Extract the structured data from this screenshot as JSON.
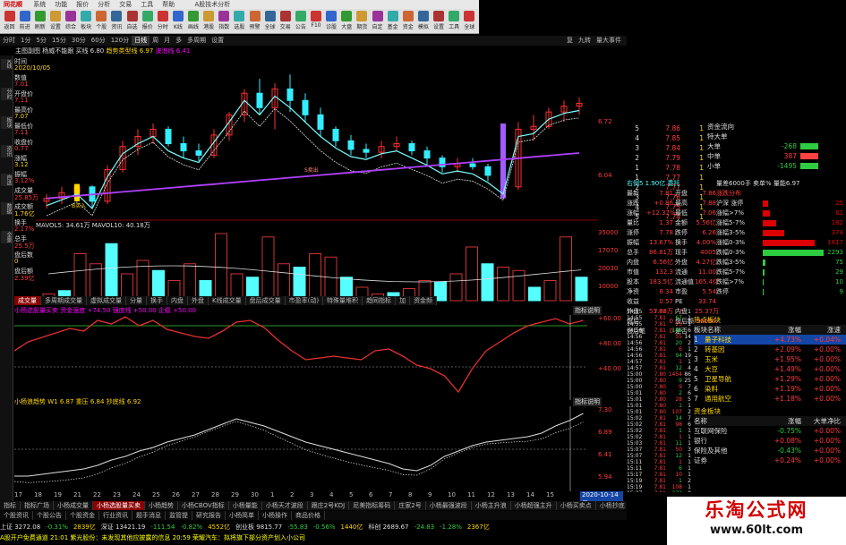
{
  "titlebar": {
    "items": [
      "系统",
      "功能",
      "报价",
      "分析",
      "交易",
      "工具",
      "帮助"
    ],
    "brand": "同花顺",
    "right": "A股技术分析"
  },
  "toolbar": {
    "buttons": [
      "返回",
      "前进",
      "刷新",
      "设置",
      "综合",
      "板块",
      "个股",
      "资讯",
      "自选",
      "报价",
      "分时",
      "K线",
      "画线",
      "港股",
      "指数",
      "选股",
      "预警",
      "全球",
      "交易",
      "公告",
      "F10",
      "诊股",
      "大盘",
      "期货",
      "自定",
      "基金",
      "资金",
      "模拟",
      "设置",
      "工具",
      "全球"
    ]
  },
  "periodbar": {
    "items": [
      "分时",
      "1分",
      "5分",
      "15分",
      "30分",
      "60分",
      "120分",
      "日线",
      "周",
      "月",
      "多",
      "多周期",
      "设置"
    ],
    "active": "日线",
    "right": [
      "复",
      "九转",
      "量大事件"
    ]
  },
  "kpanel": {
    "legend1": "主图副图 杨威不能跟 买线 6.80",
    "legend2": "趋势类型线 6.97",
    "legend3": "波浪线 6.41",
    "axis_right": [
      "6.72",
      "6.04"
    ],
    "labels": [
      "B买入",
      "S卖出"
    ],
    "left_info": [
      {
        "label": "时间",
        "value": "2020/10/05"
      },
      {
        "label": "数值",
        "value": "7.01"
      },
      {
        "label": "开盘价",
        "value": "7.11"
      },
      {
        "label": "最高价",
        "value": "7.07"
      },
      {
        "label": "最低价",
        "value": "7.11"
      },
      {
        "label": "收盘价",
        "value": "0.77"
      },
      {
        "label": "涨幅",
        "value": "3.12"
      },
      {
        "label": "振幅",
        "value": "3.12%"
      },
      {
        "label": "成交量",
        "value": "25.85万"
      },
      {
        "label": "成交额",
        "value": "1.76亿"
      },
      {
        "label": "换手",
        "value": "2.17%"
      },
      {
        "label": "总手",
        "value": "25.5万"
      },
      {
        "label": "盘后数",
        "value": "0"
      },
      {
        "label": "盘后额",
        "value": "2.39亿"
      }
    ],
    "vtabs": [
      "K线",
      "分时",
      "板块",
      "资讯",
      "自选",
      "数据",
      "全景"
    ]
  },
  "volpanel": {
    "legend": "MAVOL5: 34.61万 MAVOL10: 40.18万",
    "axis_right": [
      "35000",
      "17070",
      "20030",
      "10000"
    ]
  },
  "subtabs": [
    "成交量",
    "多周期成交量",
    "虚拟成交量",
    "分量",
    "换手",
    "内盘",
    "外盘",
    "K线成交量",
    "盘后成交量",
    "市盈率(动)",
    "特殊量堆积",
    "趋同指标",
    "加",
    "资金频"
  ],
  "ind1": {
    "legend": "小杨选股量买卖 资金强度 +74.50 强度线 +50.00 企稳 +50.00",
    "tag": "指标说明",
    "axis_right": [
      "+60.00",
      "+80.00",
      "+40.00"
    ]
  },
  "ind2": {
    "legend": "小杨浪趋势 W1 6.87 重压 6.84 抄底线 6.92",
    "tag": "指标说明",
    "axis_right": [
      "7.30",
      "6.89",
      "6.41",
      "5.94"
    ]
  },
  "date_axis": {
    "labels": [
      "17",
      "18",
      "19",
      "21",
      "22",
      "23",
      "24",
      "25",
      "26",
      "27",
      "28",
      "29",
      "30",
      "1",
      "2",
      "3",
      "4",
      "5",
      "6",
      "7",
      "8",
      "9",
      "10",
      "11",
      "12",
      "13",
      "14",
      "15"
    ],
    "highlight": "2020-10-14 三"
  },
  "bottom_tabs": [
    "指标",
    "指标广场",
    "小杨成交量",
    "小杨选股量买卖",
    "小杨趋势",
    "小杨CBOV指标",
    "小杨量能",
    "小杨天才波段",
    "跟庄2号KDJ",
    "尼美指标筹码",
    "庄家2号",
    "小杨最强波段",
    "小杨主升浪",
    "小杨超强主升",
    "小杨买卖点",
    "小杨抄底",
    "小杨指标",
    "小杨波段",
    "小杨顶部",
    "小杨MACD",
    "小杨短线",
    "小杨选股",
    "小杨指标研究"
  ],
  "bottom_tabs2": [
    "个股资讯",
    "个股公告",
    "个股资金",
    "行业资讯",
    "题手消息",
    "监管提",
    "研究报告",
    "小杨简单",
    "小杨操作",
    "商品价格"
  ],
  "quote": {
    "orderbook": [
      {
        "lvl": "5",
        "p": "7.86",
        "v": "1"
      },
      {
        "lvl": "4",
        "p": "7.85",
        "v": "1"
      },
      {
        "lvl": "3",
        "p": "7.84",
        "v": "1"
      },
      {
        "lvl": "2",
        "p": "7.79",
        "v": "1"
      },
      {
        "lvl": "1",
        "p": "7.78",
        "v": "1"
      },
      {
        "lvl": "1",
        "p": "7.77",
        "v": "1"
      },
      {
        "lvl": "2",
        "p": "7.77",
        "v": "1"
      },
      {
        "lvl": "3",
        "p": "7.76",
        "v": "1"
      },
      {
        "lvl": "4",
        "p": "7.75",
        "v": "1"
      },
      {
        "lvl": "5",
        "p": "7.74",
        "v": "1"
      }
    ],
    "header": "右侧5 1.90亿 委托",
    "header2": "量差6000手 卖单% 量能6.97",
    "stats": [
      [
        "最新",
        "7.81",
        "开盘",
        "7.86"
      ],
      [
        "涨跌",
        "+0.86",
        "最高",
        "7.88"
      ],
      [
        "涨幅",
        "+12.37%",
        "最低",
        "7.06"
      ],
      [
        "量比",
        "1.37",
        "金额",
        "5.56亿"
      ],
      [
        "涨停",
        "7.78",
        "跌停",
        "6.26"
      ],
      [
        "振幅",
        "13.67%",
        "换手",
        "4.00%"
      ],
      [
        "总手",
        "86.81万",
        "现手",
        "4005"
      ],
      [
        "内盘",
        "6.56亿",
        "外盘",
        "4.27亿"
      ],
      [
        "市值",
        "132.3",
        "流通",
        "11.00"
      ],
      [
        "股本",
        "183.5亿",
        "流通值",
        "165.4亿"
      ],
      [
        "净资",
        "8.34",
        "市盈",
        "5.54"
      ],
      [
        "收益",
        "0.57",
        "PE",
        "33.74"
      ],
      [
        "外盘",
        "53.08万",
        "内盘",
        "25.37万"
      ],
      [
        "盘后",
        "0",
        "盘后额",
        "96064"
      ],
      [
        "盘后笔",
        "0",
        "是否",
        "否"
      ]
    ],
    "ticks": [
      [
        "14:55",
        "7.81",
        "7",
        "1"
      ],
      [
        "14:55",
        "7.81",
        "67",
        "1"
      ],
      [
        "14:55",
        "7.81",
        "25",
        "1"
      ],
      [
        "14:56",
        "7.81",
        "196",
        "6"
      ],
      [
        "14:56",
        "7.81",
        "55",
        "14"
      ],
      [
        "14:56",
        "7.81",
        "20",
        "2"
      ],
      [
        "14:56",
        "7.81",
        "6",
        "1"
      ],
      [
        "14:56",
        "7.81",
        "94",
        "19"
      ],
      [
        "14:57",
        "7.81",
        "1",
        "1"
      ],
      [
        "14:57",
        "7.81",
        "12",
        "4"
      ],
      [
        "15:00",
        "7.80",
        "1454",
        "86"
      ],
      [
        "15:00",
        "7.80",
        "9",
        "25"
      ],
      [
        "15:00",
        "7.80",
        "9",
        "7"
      ],
      [
        "15:01",
        "7.80",
        "2",
        "6"
      ],
      [
        "15:01",
        "7.80",
        "28",
        "5"
      ],
      [
        "15:01",
        "7.80",
        "1",
        "1"
      ],
      [
        "15:01",
        "7.80",
        "107",
        "2"
      ],
      [
        "15:02",
        "7.81",
        "14",
        "7"
      ],
      [
        "15:02",
        "7.81",
        "98",
        "6"
      ],
      [
        "15:02",
        "7.81",
        "1",
        "1"
      ],
      [
        "15:02",
        "7.81",
        "1",
        "1"
      ],
      [
        "15:03",
        "7.81",
        "11",
        "1"
      ],
      [
        "15:07",
        "7.81",
        "50",
        "3"
      ],
      [
        "15:07",
        "7.81",
        "12",
        "1"
      ],
      [
        "15:11",
        "7.81",
        "1",
        "1"
      ],
      [
        "15:11",
        "7.81",
        "6",
        "1"
      ],
      [
        "15:17",
        "7.81",
        "10",
        "1"
      ],
      [
        "15:19",
        "7.81",
        "1",
        "2"
      ],
      [
        "15:19",
        "7.81",
        "108",
        "1"
      ],
      [
        "15:27",
        "7.81",
        "232",
        "8"
      ]
    ]
  },
  "flow": {
    "title": "资金流向",
    "rows": [
      {
        "name": "特大单",
        "value": "",
        "color": "#ff4040"
      },
      {
        "name": "大单",
        "value": "-268",
        "color": "#2ecc40"
      },
      {
        "name": "中单",
        "value": "387",
        "color": "#ff4040"
      },
      {
        "name": "小单",
        "value": "-1495",
        "color": "#2ecc40"
      }
    ]
  },
  "distribution": {
    "title": "涨跌分布",
    "rows": [
      {
        "name": "沪深 涨停",
        "v": "25",
        "w": 0.09,
        "c": "#d00"
      },
      {
        "name": "涨幅>7%",
        "v": "61",
        "w": 0.12,
        "c": "#d00"
      },
      {
        "name": "涨幅5-7%",
        "v": "182",
        "w": 0.22,
        "c": "#d00"
      },
      {
        "name": "涨幅3-5%",
        "v": "374",
        "w": 0.35,
        "c": "#d00"
      },
      {
        "name": "涨幅0-3%",
        "v": "1617",
        "w": 0.85,
        "c": "#d00"
      },
      {
        "name": "跌幅0-3%",
        "v": "2293",
        "w": 1.0,
        "c": "#2ecc40"
      },
      {
        "name": "跌幅3-5%",
        "v": "75",
        "w": 0.05,
        "c": "#2ecc40"
      },
      {
        "name": "跌幅5-7%",
        "v": "29",
        "w": 0.03,
        "c": "#2ecc40"
      },
      {
        "name": "跌幅>7%",
        "v": "10",
        "w": 0.02,
        "c": "#2ecc40"
      },
      {
        "name": "跌停",
        "v": "9",
        "w": 0.02,
        "c": "#2ecc40"
      }
    ]
  },
  "sectors": {
    "title": "热点板块",
    "headers": [
      "板块名称",
      "涨幅",
      "涨速"
    ],
    "rows": [
      {
        "idx": "1",
        "name": "量子科技",
        "chg": "+4.73%",
        "spd": "+0.04%",
        "sel": true
      },
      {
        "idx": "2",
        "name": "转基因",
        "chg": "+2.09%",
        "spd": "+0.00%"
      },
      {
        "idx": "3",
        "name": "玉米",
        "chg": "+1.95%",
        "spd": "+0.00%"
      },
      {
        "idx": "4",
        "name": "大豆",
        "chg": "+1.49%",
        "spd": "+0.00%"
      },
      {
        "idx": "5",
        "name": "卫星导航",
        "chg": "+1.29%",
        "spd": "+0.00%"
      },
      {
        "idx": "6",
        "name": "染料",
        "chg": "+1.19%",
        "spd": "+0.00%"
      },
      {
        "idx": "7",
        "name": "通用航空",
        "chg": "+1.18%",
        "spd": "+0.00%"
      }
    ]
  },
  "sectors2": {
    "title": "资金板块",
    "headers": [
      "名称",
      "涨幅",
      "大单净比"
    ],
    "rows": [
      {
        "name": "互联网保险",
        "chg": "-0.75%",
        "net": "+0.00%"
      },
      {
        "name": "银行",
        "chg": "+0.08%",
        "net": "+0.00%"
      },
      {
        "name": "保险及其他",
        "chg": "-0.43%",
        "net": "+0.00%"
      },
      {
        "name": "证券",
        "chg": "+0.24%",
        "net": "+0.00%"
      }
    ]
  },
  "statusbar": {
    "indices": [
      "上证 3272.08",
      "-0.31%",
      "2839亿",
      "深证 13421.19",
      "-111.54",
      "-0.82%",
      "4552亿",
      "创业板 9815.77",
      "-55.83",
      "-0.56%",
      "1440亿",
      "科创 2689.67",
      "-24.83",
      "-1.28%",
      "2367亿"
    ],
    "news": "A股开户免费通道   21:01 紫光股份：未发现其他应披露的信息  20:59 荣耀汽车：拟将旗下部分资产划入小公司"
  },
  "watermark": {
    "title": "乐淘公式网",
    "url": "www.60lt.com"
  }
}
